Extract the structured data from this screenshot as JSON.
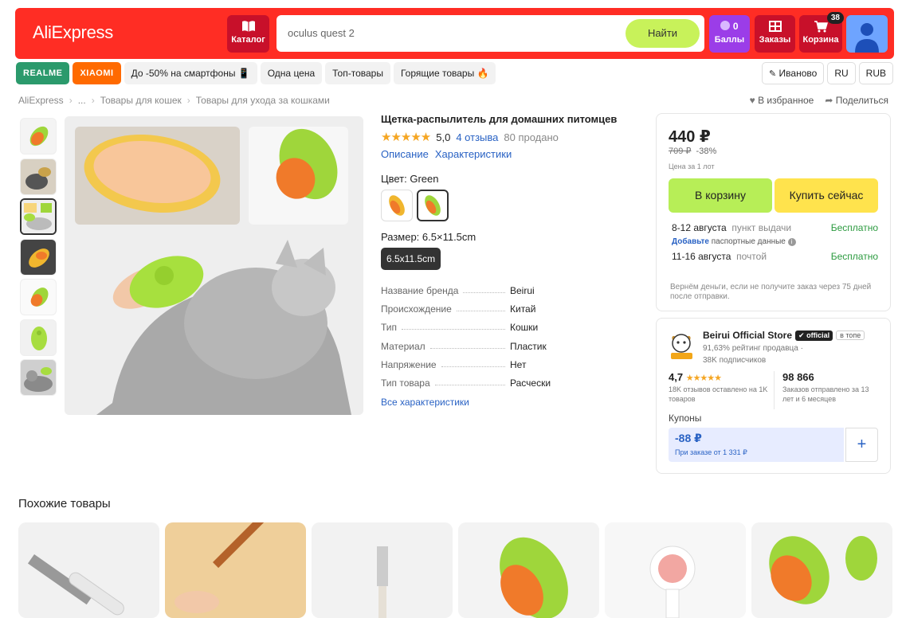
{
  "header": {
    "logo": "AliExpress",
    "catalog_label": "Каталог",
    "search_value": "oculus quest 2",
    "search_button": "Найти",
    "points_value": "0",
    "points_label": "Баллы",
    "orders_label": "Заказы",
    "cart_label": "Корзина",
    "cart_count": "38"
  },
  "tags": [
    "REALME",
    "XIAOMI",
    "До -50% на смартфоны 📱",
    "Одна цена",
    "Топ-товары",
    "Горящие товары 🔥"
  ],
  "location": "Иваново",
  "language": "RU",
  "currency": "RUB",
  "breadcrumb": [
    "AliExpress",
    "...",
    "Товары для кошек",
    "Товары для ухода за кошками"
  ],
  "actions": {
    "favorite": "В избранное",
    "share": "Поделиться"
  },
  "product": {
    "title": "Щетка-распылитель для домашних питомцев",
    "stars": "★★★★★",
    "rating": "5,0",
    "reviews": "4 отзыва",
    "sold": "80 продано",
    "tab_description": "Описание",
    "tab_specs": "Характеристики",
    "color_label": "Цвет: Green",
    "size_label": "Размер: 6.5×11.5cm",
    "size_option": "6.5x11.5cm",
    "specs": [
      {
        "k": "Название бренда",
        "v": "Beirui"
      },
      {
        "k": "Происхождение",
        "v": "Китай"
      },
      {
        "k": "Тип",
        "v": "Кошки"
      },
      {
        "k": "Материал",
        "v": "Пластик"
      },
      {
        "k": "Напряжение",
        "v": "Нет"
      },
      {
        "k": "Тип товара",
        "v": "Расчески"
      }
    ],
    "all_specs": "Все характеристики"
  },
  "buy": {
    "price": "440 ₽",
    "old_price": "709 ₽",
    "discount": "-38%",
    "per_lot": "Цена за 1 лот",
    "add_to_cart": "В корзину",
    "buy_now": "Купить сейчас",
    "delivery1_date": "8-12 августа",
    "delivery1_method": "пункт выдачи",
    "delivery1_price": "Бесплатно",
    "passport_add": "Добавьте",
    "passport_rest": "паспортные данные",
    "delivery2_date": "11-16 августа",
    "delivery2_method": "почтой",
    "delivery2_price": "Бесплатно",
    "refund": "Вернём деньги, если не получите заказ через 75 дней после отправки."
  },
  "store": {
    "name": "Beirui Official Store",
    "official": "official",
    "top": "в топе",
    "rating_line": "91,63% рейтинг продавца",
    "subscribers": "38K подписчиков",
    "score": "4,7",
    "score_stars": "★★★★★",
    "score_desc": "18K отзывов оставлено на 1K товаров",
    "orders": "98 866",
    "orders_desc": "Заказов отправлено за 13 лет и 6 месяцев",
    "coupons_label": "Купоны",
    "coupon_value": "-88 ₽",
    "coupon_cond": "При заказе от 1 331 ₽"
  },
  "similar_title": "Похожие товары",
  "colors": {
    "accent": "#ff2d24",
    "green_btn": "#b7ee57",
    "yellow_btn": "#ffe34d",
    "link": "#2962c4"
  }
}
